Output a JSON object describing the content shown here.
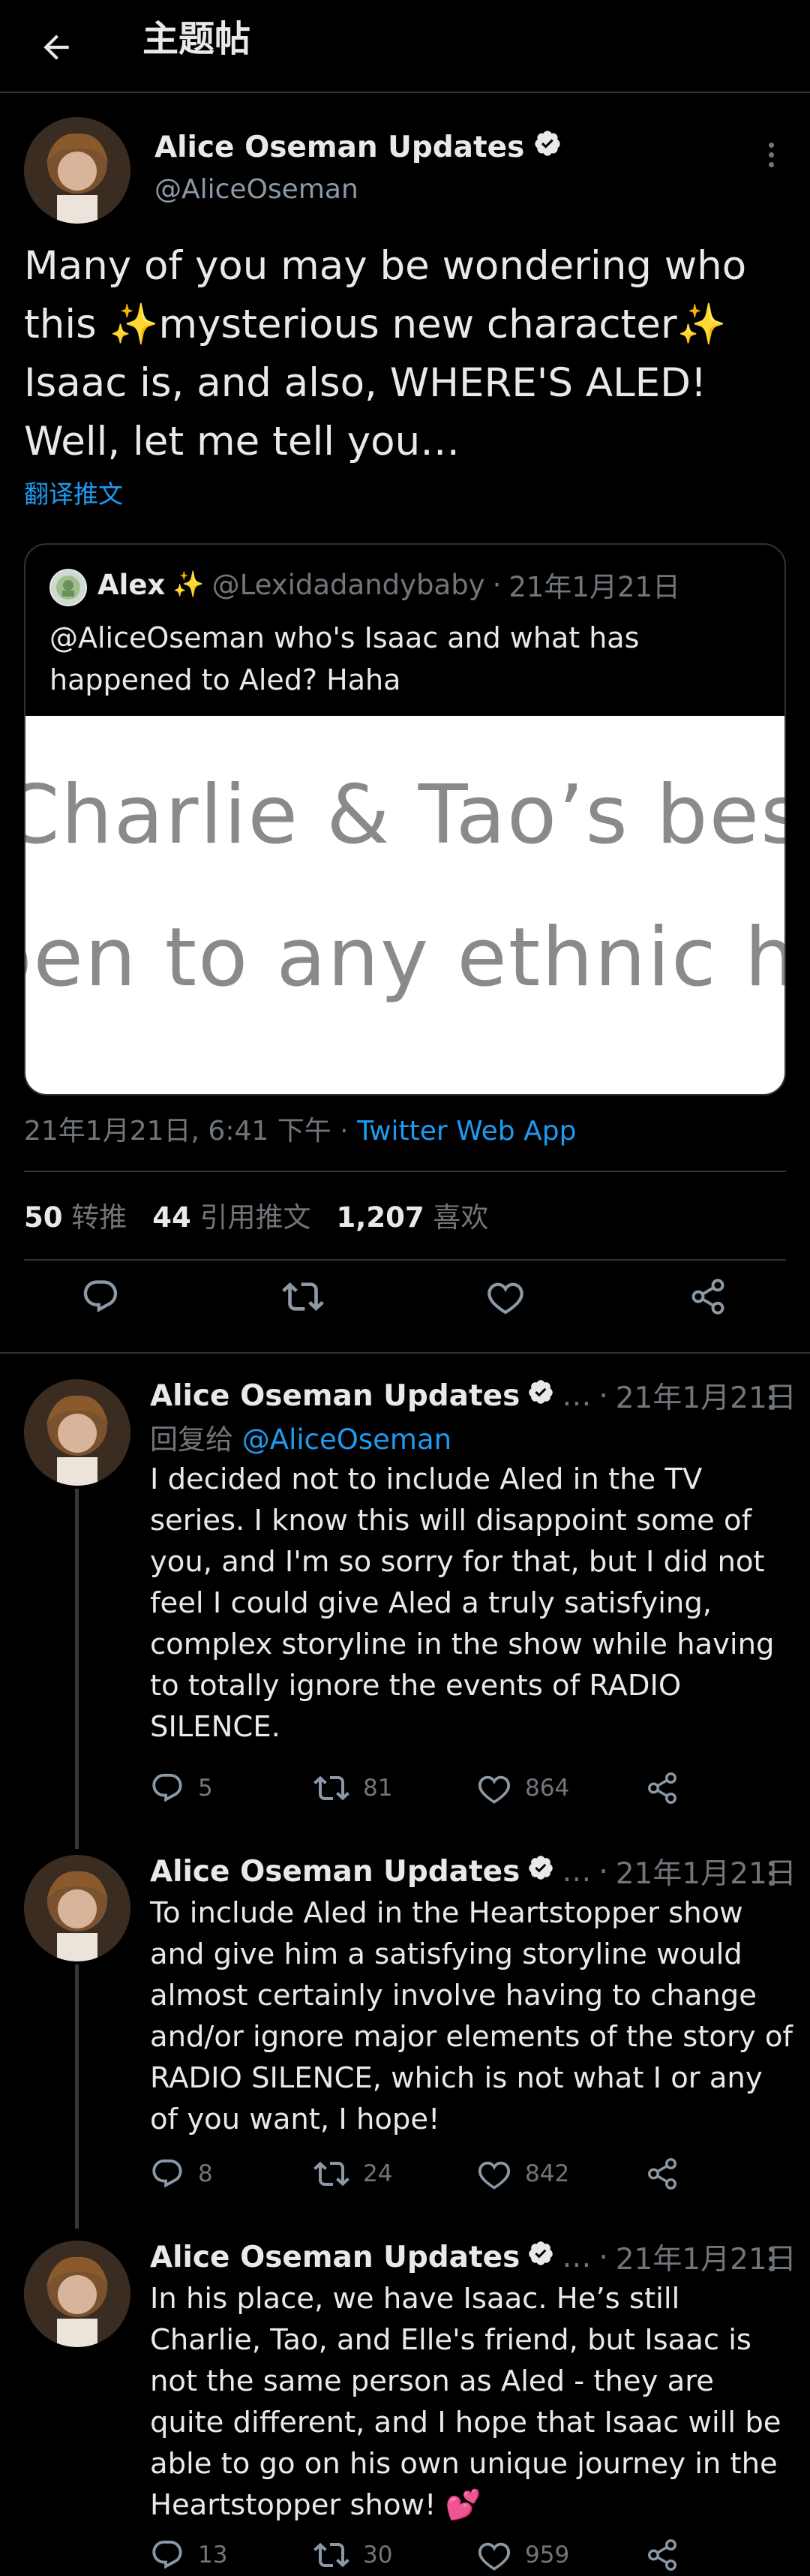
{
  "header": {
    "title": "主题帖"
  },
  "main_tweet": {
    "author_name": "Alice Oseman Updates",
    "handle": "@AliceOseman",
    "text": "Many of you may be wondering who this ✨mysterious new character✨ Isaac is, and also, WHERE'S ALED! Well, let me tell you…",
    "translate_label": "翻译推文",
    "quote": {
      "author_name": "Alex",
      "handle": "@Lexidadandybaby",
      "dot": "·",
      "date": "21年1月21日",
      "text": "@AliceOseman who's Isaac and what has happened to Aled? Haha",
      "image_lines": [
        "Charlie & Tao’s bes",
        "pen to any ethnic her"
      ]
    },
    "timestamp": "21年1月21日, 6:41 下午",
    "dot": "·",
    "source_app": "Twitter Web App",
    "stats": {
      "retweets": "50",
      "retweets_label": "转推",
      "quotes": "44",
      "quotes_label": "引用推文",
      "likes": "1,207",
      "likes_label": "喜欢"
    },
    "icons": [
      "reply-icon",
      "retweet-icon",
      "like-icon",
      "share-icon"
    ]
  },
  "replies": [
    {
      "author_name": "Alice Oseman Updates",
      "truncation": "…",
      "dot": "·",
      "date": "21年1月21日",
      "reply_to_label": "回复给",
      "reply_to_handle": "@AliceOseman",
      "text": "I decided not to include Aled in the TV series. I know this will disappoint some of you, and I'm so sorry for that, but I did not feel I could give Aled a truly satisfying, complex storyline in the show while having to totally ignore the events of RADIO SILENCE.",
      "replies": "5",
      "retweets": "81",
      "likes": "864"
    },
    {
      "author_name": "Alice Oseman Updates",
      "truncation": "…",
      "dot": "·",
      "date": "21年1月21日",
      "text": "To include Aled in the Heartstopper show and give him a satisfying storyline would almost certainly involve having to change and/or ignore major elements of the story of RADIO SILENCE, which is not what I or any of you want, I hope!",
      "replies": "8",
      "retweets": "24",
      "likes": "842"
    },
    {
      "author_name": "Alice Oseman Updates",
      "truncation": "…",
      "dot": "·",
      "date": "21年1月21日",
      "text": "In his place, we have Isaac. He’s still Charlie, Tao, and Elle's friend, but Isaac is not the same person as Aled - they are quite different, and I hope that Isaac will be able to go on his own unique journey in the Heartstopper show!",
      "emoji": "💕",
      "replies": "13",
      "retweets": "30",
      "likes": "959"
    }
  ],
  "colors": {
    "background": "#000000",
    "link": "#1d9bf0",
    "muted": "#71767b",
    "divider": "#2f3336"
  }
}
